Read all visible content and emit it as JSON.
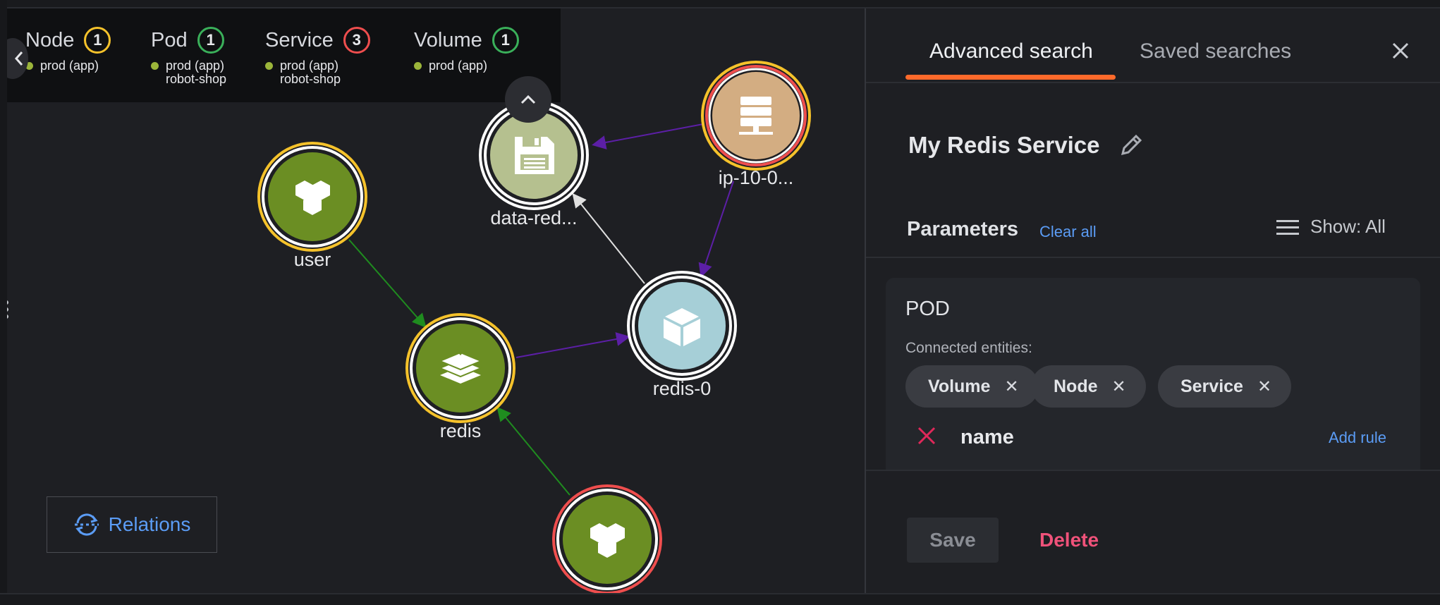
{
  "legend": {
    "groups": [
      {
        "name": "Node",
        "count": "1",
        "count_color": "#f5c22b",
        "lines": [
          "prod (app)"
        ]
      },
      {
        "name": "Pod",
        "count": "1",
        "count_color": "#3ab05a",
        "lines": [
          "prod (app)",
          "robot-shop"
        ]
      },
      {
        "name": "Service",
        "count": "3",
        "count_color": "#ef4e4e",
        "lines": [
          "prod (app)",
          "robot-shop"
        ]
      },
      {
        "name": "Volume",
        "count": "1",
        "count_color": "#3ab05a",
        "lines": [
          "prod (app)"
        ]
      }
    ],
    "dot_color": "#9bb53a"
  },
  "graph": {
    "nodes": [
      {
        "id": "user",
        "label": "user",
        "fill": "#6b8e23",
        "ring": "#f5c22b",
        "icon": "cubes-icon"
      },
      {
        "id": "data",
        "label": "data-red...",
        "fill": "#b5c08f",
        "ring": "#ffffff",
        "icon": "floppy-disk-icon"
      },
      {
        "id": "ip",
        "label": "ip-10-0...",
        "fill": "#d3ad82",
        "ring": "#f5c22b",
        "inner_ring": "#ef4e4e",
        "icon": "server-icon"
      },
      {
        "id": "redis",
        "label": "redis",
        "fill": "#6b8e23",
        "ring": "#f5c22b",
        "icon": "database-layers-icon"
      },
      {
        "id": "redis0",
        "label": "redis-0",
        "fill": "#a6cfd7",
        "ring": "#ffffff",
        "icon": "cube-icon"
      },
      {
        "id": "bottom",
        "label": "",
        "fill": "#6b8e23",
        "ring": "#ef4e4e",
        "icon": "cubes-icon"
      }
    ],
    "edge_colors": {
      "green": "#1f8c1f",
      "purple": "#5c1fa6",
      "white": "#e0e0e0"
    }
  },
  "relations_label": "Relations",
  "panel": {
    "tabs": [
      "Advanced search",
      "Saved searches"
    ],
    "accent": "#ff6a2b",
    "search_name": "My Redis Service",
    "parameters_label": "Parameters",
    "clear_all": "Clear all",
    "show_label": "Show: All",
    "card": {
      "entity": "POD",
      "connected_label": "Connected entities:",
      "chips": [
        "Volume",
        "Node",
        "Service"
      ],
      "rule_name": "name",
      "add_rule": "Add rule"
    },
    "save": "Save",
    "delete": "Delete"
  }
}
